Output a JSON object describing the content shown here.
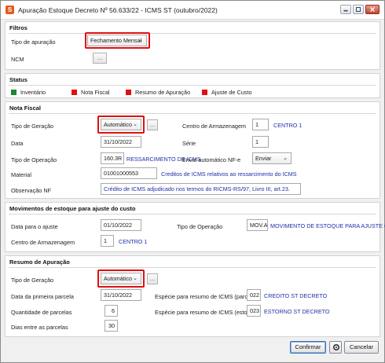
{
  "window": {
    "title": "Apuração Estoque Decreto Nº 56.633/22 - ICMS ST (outubro/2022)"
  },
  "filtros": {
    "section": "Filtros",
    "tipo_label": "Tipo de apuração",
    "tipo_value": "Fechamento Mensal",
    "ncm_label": "NCM",
    "ncm_button": "..."
  },
  "status": {
    "section": "Status",
    "items": [
      {
        "label": "Inventário",
        "color": "#1a8a2e"
      },
      {
        "label": "Nota Fiscal",
        "color": "#e01010"
      },
      {
        "label": "Resumo de Apuração",
        "color": "#e01010"
      },
      {
        "label": "Ajuste de Custo",
        "color": "#e01010"
      }
    ]
  },
  "nota_fiscal": {
    "section": "Nota Fiscal",
    "tipo_geracao_label": "Tipo de Geração",
    "tipo_geracao_value": "Automático",
    "dots": "...",
    "centro_label": "Centro de Armazenagem",
    "centro_value": "1",
    "centro_desc": "CENTRO 1",
    "data_label": "Data",
    "data_value": "31/10/2022",
    "serie_label": "Série",
    "serie_value": "1",
    "tipo_operacao_label": "Tipo de Operação",
    "tipo_operacao_value": "160.3R",
    "tipo_operacao_desc": "RESSARCIMENTO DE ICMS",
    "envio_label": "Envio automático NF-e",
    "envio_value": "Enviar",
    "material_label": "Material",
    "material_value": "01001000553",
    "material_desc": "Creditos de ICMS relativos ao ressarcimento do ICMS",
    "obs_label": "Observação NF",
    "obs_value": "Crédito de ICMS adjudicado nos termos do RICMS-RS/97, Livro III, art.23."
  },
  "movimentos": {
    "section": "Movimentos de estoque para ajuste do custo",
    "data_label": "Data para o ajuste",
    "data_value": "01/10/2022",
    "tipo_operacao_label": "Tipo de Operação",
    "tipo_operacao_value": "MOV.AJ",
    "tipo_operacao_desc": "MOVIMENTO DE ESTOQUE PARA AJUSTE CUSTO",
    "centro_label": "Centro de Armazenagem",
    "centro_value": "1",
    "centro_desc": "CENTRO 1"
  },
  "resumo": {
    "section": "Resumo de Apuração",
    "tipo_geracao_label": "Tipo de Geração",
    "tipo_geracao_value": "Automático",
    "dots": "...",
    "data_primeira_label": "Data da primeira parcela",
    "data_primeira_value": "31/10/2022",
    "especie_parcelas_label": "Espécie para resumo de ICMS (parcelas)",
    "especie_parcelas_value": "022",
    "especie_parcelas_desc": "CREDITO ST DECRETO",
    "quantidade_label": "Quantidade de parcelas",
    "quantidade_value": "6",
    "especie_estorno_label": "Espécie para resumo de ICMS (estorno)",
    "especie_estorno_value": "023",
    "especie_estorno_desc": "ESTORNO ST DECRETO",
    "dias_label": "Dias entre as parcelas",
    "dias_value": "30"
  },
  "footer": {
    "confirm_label": "Confirmar",
    "cancel_label": "Cancelar"
  },
  "icons": {
    "app": "app-logo-icon",
    "minimize": "minimize-icon",
    "maximize": "maximize-icon",
    "close": "close-icon",
    "chevron": "chevron-down-icon",
    "gear": "gear-icon"
  }
}
